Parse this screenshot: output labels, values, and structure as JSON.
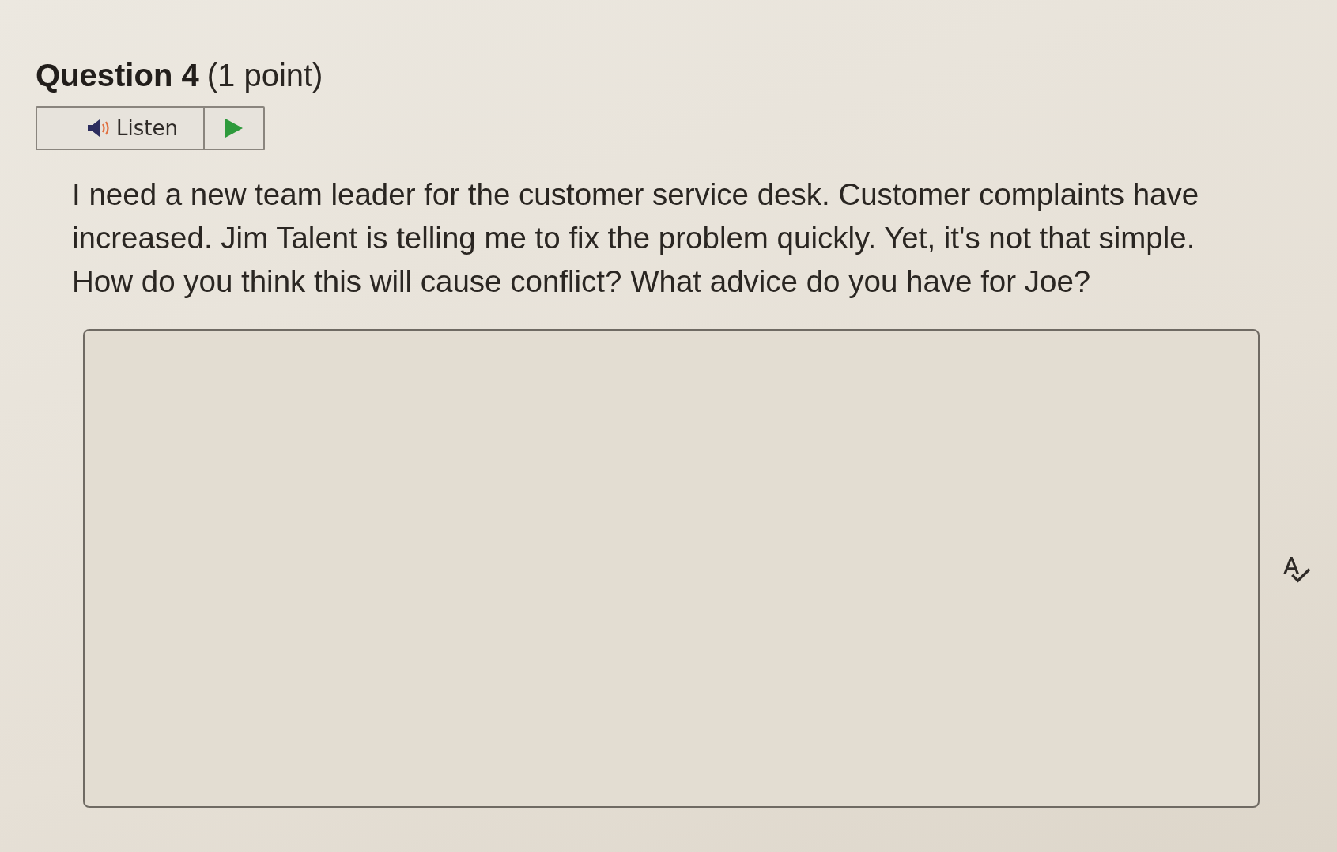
{
  "question": {
    "title": "Question 4",
    "points": "(1 point)"
  },
  "listen_button": {
    "label": "Listen"
  },
  "prompt": "I need a new team leader for the customer service desk. Customer complaints have increased. Jim Talent is telling me to fix the problem quickly. Yet, it's not that simple. How do you think this will cause conflict? What advice do you have for Joe?"
}
